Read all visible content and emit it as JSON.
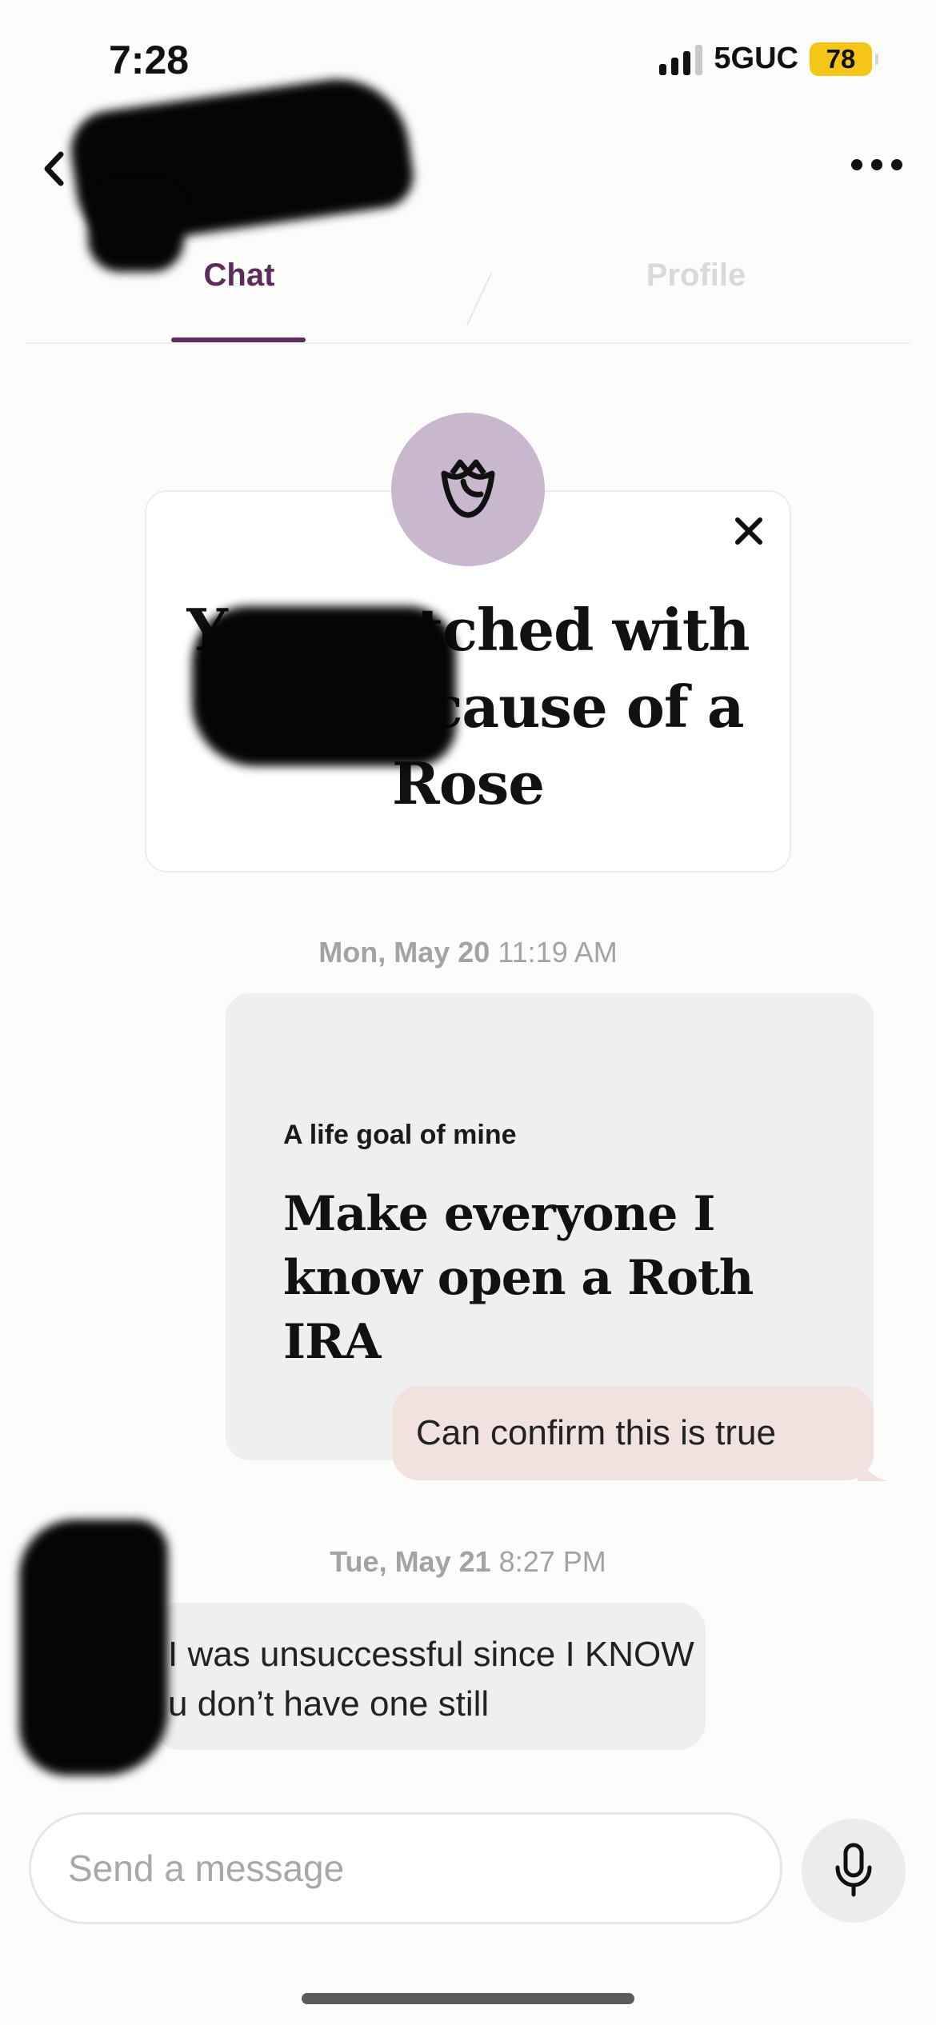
{
  "status_bar": {
    "time": "7:28",
    "network": "5GUC",
    "battery": "78"
  },
  "header": {
    "back_icon": "chevron-left-icon",
    "more_icon": "ellipsis-icon"
  },
  "tabs": [
    {
      "label": "Chat",
      "active": true
    },
    {
      "label": "Profile",
      "active": false
    }
  ],
  "match_card": {
    "icon": "rose-icon",
    "line1": "You matched with",
    "line2": "because of a",
    "line3": "Rose"
  },
  "messages": {
    "date1": {
      "day": "Mon, May 20",
      "time": "11:19 AM"
    },
    "prompt_question": "A life goal of mine",
    "prompt_answer": "Make everyone I know open a Roth IRA",
    "sent_text": "Can confirm this is true",
    "date2": {
      "day": "Tue, May 21",
      "time": "8:27 PM"
    },
    "received_text": "I was unsuccessful since I KNOW u don’t have one still"
  },
  "composer": {
    "placeholder": "Send a message",
    "mic_icon": "microphone-icon"
  },
  "colors": {
    "accent": "#5b2c5c",
    "rose_circle": "#c9b8cd",
    "sent_bubble": "#f1e2df",
    "battery": "#f5c617"
  }
}
